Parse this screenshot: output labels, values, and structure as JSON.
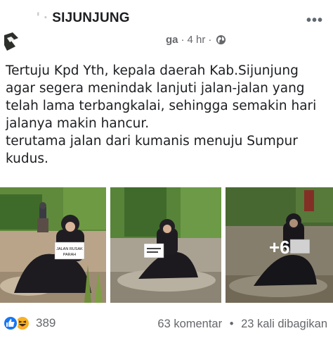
{
  "header": {
    "group_name_prefix": "' ·",
    "group_name": "SIJUNJUNG",
    "author_partial": "ga",
    "time": "4 hr",
    "more_icon": "ellipsis-icon",
    "privacy_icon": "globe-icon"
  },
  "post": {
    "paragraph1": "Tertuju Kpd Yth, kepala daerah Kab.Sijunjung agar segera menindak lanjuti jalan-jalan yang telah lama terbangkalai, sehingga semakin hari jalanya makin hancur.",
    "paragraph2": "terutama jalan dari kumanis menuju Sumpur kudus."
  },
  "photos": {
    "sign_text_1": "JALAN RUSAK",
    "sign_text_2": "PARAH",
    "more_count": "+6"
  },
  "footer": {
    "reaction_count": "389",
    "comments": "63 komentar",
    "separator": "•",
    "shares": "23 kali dibagikan"
  },
  "colors": {
    "like_blue": "#1877f2",
    "haha_yellow": "#f7b125",
    "meta_gray": "#65676b"
  }
}
